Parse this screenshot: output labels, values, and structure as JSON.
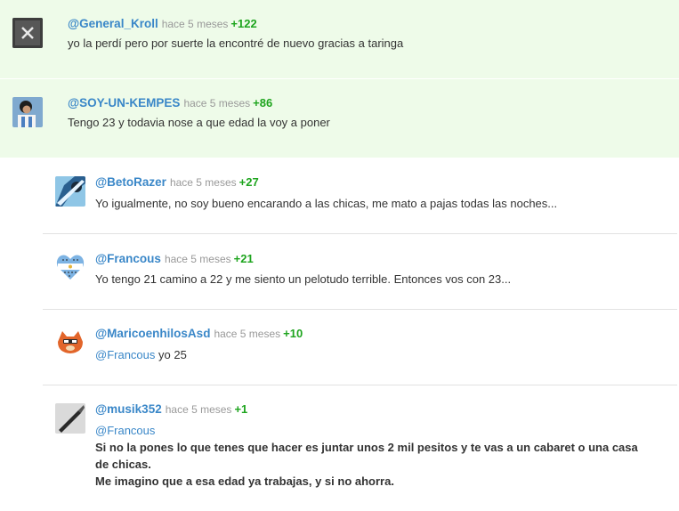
{
  "comments": [
    {
      "user": "@General_Kroll",
      "time": "hace 5 meses",
      "votes": "+122",
      "text": "yo la perdí pero por suerte la encontré de nuevo gracias a taringa"
    },
    {
      "user": "@SOY-UN-KEMPES",
      "time": "hace 5 meses",
      "votes": "+86",
      "text": "Tengo 23 y todavia nose a que edad la voy a poner"
    },
    {
      "user": "@BetoRazer",
      "time": "hace 5 meses",
      "votes": "+27",
      "text": "Yo igualmente, no soy bueno encarando a las chicas, me mato a pajas todas las noches..."
    },
    {
      "user": "@Francous",
      "time": "hace 5 meses",
      "votes": "+21",
      "text": "Yo tengo 21 camino a 22 y me siento un pelotudo terrible. Entonces vos con 23..."
    },
    {
      "user": "@MaricoenhilosAsd",
      "time": "hace 5 meses",
      "votes": "+10",
      "mention": "@Francous",
      "text": "yo 25"
    },
    {
      "user": "@musik352",
      "time": "hace 5 meses",
      "votes": "+1",
      "mention": "@Francous",
      "lines": [
        "Si no la pones lo que tenes que hacer es juntar unos 2 mil pesitos y te vas a un cabaret o una casa",
        "de chicas.",
        "Me imagino que a esa edad ya trabajas, y si no ahorra."
      ]
    }
  ],
  "colors": {
    "username": "#3a87c8",
    "votes": "#1fa51f",
    "highlight_bg": "#eefbe9",
    "timestamp": "#999999"
  }
}
